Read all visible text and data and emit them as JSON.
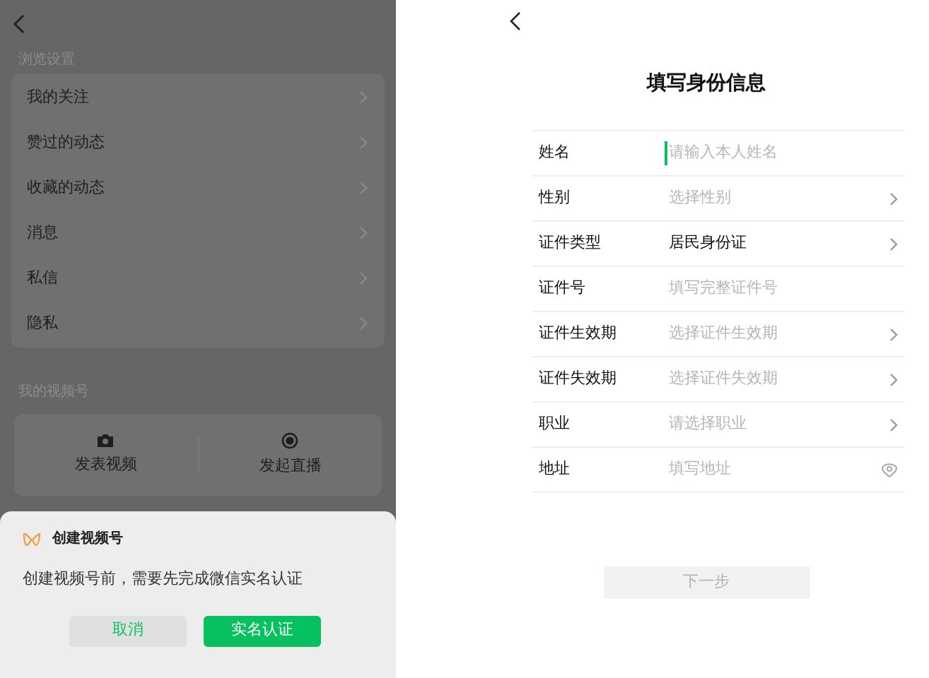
{
  "left_screen": {
    "dimmed": true,
    "browse_section": {
      "title": "浏览设置",
      "items": [
        {
          "label": "我的关注"
        },
        {
          "label": "赞过的动态"
        },
        {
          "label": "收藏的动态"
        },
        {
          "label": "消息"
        },
        {
          "label": "私信"
        },
        {
          "label": "隐私"
        }
      ]
    },
    "channel_section": {
      "title": "我的视频号",
      "actions": [
        {
          "kind": "camera",
          "label": "发表视频"
        },
        {
          "kind": "live",
          "label": "发起直播"
        }
      ]
    },
    "sheet": {
      "title": "创建视频号",
      "message": "创建视频号前，需要先完成微信实名认证",
      "buttons": [
        {
          "kind": "secondary",
          "label": "取消"
        },
        {
          "kind": "primary",
          "label": "实名认证"
        }
      ]
    }
  },
  "right_screen": {
    "title": "填写身份信息",
    "fields": [
      {
        "kind": "input",
        "label": "姓名",
        "placeholder": "请输入本人姓名",
        "focused": true
      },
      {
        "kind": "select",
        "label": "性别",
        "placeholder": "选择性别"
      },
      {
        "kind": "select",
        "label": "证件类型",
        "value": "居民身份证"
      },
      {
        "kind": "input",
        "label": "证件号",
        "placeholder": "填写完整证件号",
        "focused": false
      },
      {
        "kind": "select",
        "label": "证件生效期",
        "placeholder": "选择证件生效期"
      },
      {
        "kind": "select",
        "label": "证件失效期",
        "placeholder": "选择证件失效期"
      },
      {
        "kind": "select",
        "label": "职业",
        "placeholder": "请选择职业"
      },
      {
        "kind": "location",
        "label": "地址",
        "placeholder": "填写地址"
      }
    ],
    "next_button": {
      "label": "下一步",
      "disabled": true
    }
  }
}
